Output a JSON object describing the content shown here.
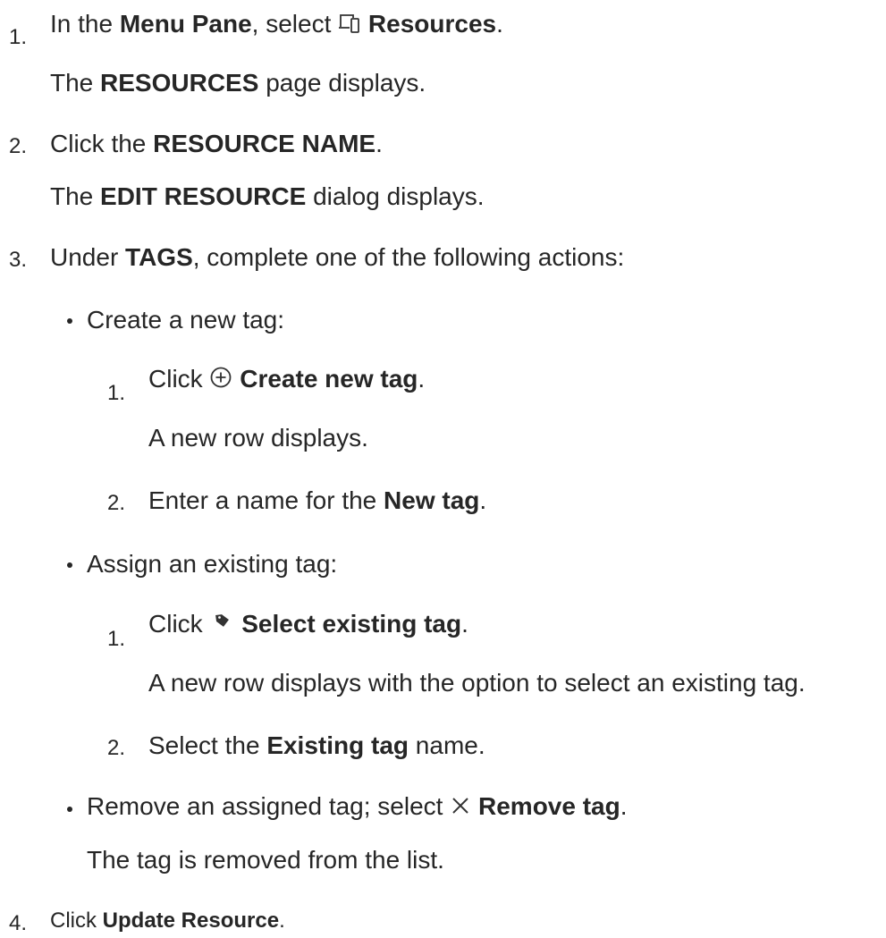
{
  "steps": {
    "s1": {
      "number": "1.",
      "pre": "In the",
      "menu_pane": "Menu Pane",
      "mid": ", select",
      "resources": "Resources",
      "end": ".",
      "result_pre": "The",
      "result_bold": "RESOURCES",
      "result_post": "page displays."
    },
    "s2": {
      "number": "2.",
      "pre": "Click the",
      "bold": "RESOURCE NAME",
      "end": ".",
      "result_pre": "The",
      "result_bold": "EDIT RESOURCE",
      "result_post": "dialog displays."
    },
    "s3": {
      "number": "3.",
      "pre": "Under",
      "bold": "TAGS",
      "post": ", complete one of the following actions:",
      "create": {
        "label": "Create a new tag:",
        "sub1_number": "1.",
        "sub1_pre": "Click",
        "sub1_bold": "Create new tag",
        "sub1_end": ".",
        "sub1_result": "A new row displays.",
        "sub2_number": "2.",
        "sub2_pre": "Enter a name for the",
        "sub2_bold": "New tag",
        "sub2_end": "."
      },
      "assign": {
        "label": "Assign an existing tag:",
        "sub1_number": "1.",
        "sub1_pre": "Click",
        "sub1_bold": "Select existing tag",
        "sub1_end": ".",
        "sub1_result": "A new row displays with the option to select an existing tag.",
        "sub2_number": "2.",
        "sub2_pre": "Select the",
        "sub2_bold": "Existing tag",
        "sub2_post": "name."
      },
      "remove": {
        "pre": "Remove an assigned tag; select",
        "bold": "Remove tag",
        "end": ".",
        "result": "The tag is removed from the list."
      }
    },
    "s4": {
      "number": "4.",
      "pre": "Click",
      "bold": "Update Resource",
      "end": "."
    }
  },
  "icons": {
    "resources": "devices-icon",
    "create": "plus-circle-icon",
    "select": "tag-icon",
    "remove": "close-icon"
  },
  "colors": {
    "text": "#262626",
    "icon": "#333333"
  }
}
